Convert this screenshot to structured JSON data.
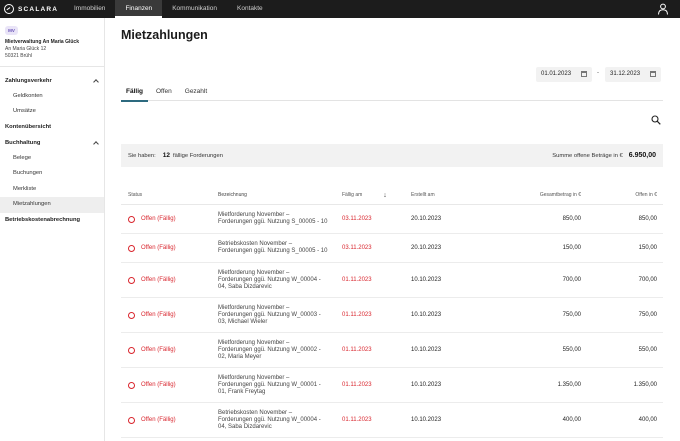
{
  "app": {
    "logo_text": "SCALARA"
  },
  "nav": {
    "items": [
      "Immobilien",
      "Finanzen",
      "Kommunikation",
      "Kontakte"
    ],
    "active": "Finanzen"
  },
  "sidebar": {
    "avatar": "MV",
    "name": "Mietverwaltung An Maria Glück",
    "address_line1": "An Maria Glück 12",
    "address_line2": "50321 Brühl",
    "groups": [
      {
        "label": "Zahlungsverkehr",
        "items": [
          "Geldkonten",
          "Umsätze"
        ]
      },
      {
        "label": "Kontenübersicht",
        "items": []
      },
      {
        "label": "Buchhaltung",
        "items": [
          "Belege",
          "Buchungen",
          "Merkliste",
          "Mietzahlungen"
        ]
      },
      {
        "label": "Betriebskostenabrechnung",
        "items": []
      }
    ],
    "active_item": "Mietzahlungen"
  },
  "main": {
    "title": "Mietzahlungen",
    "date_from": "01.01.2023",
    "date_separator": "-",
    "date_to": "31.12.2023",
    "tabs": [
      "Fällig",
      "Offen",
      "Gezahlt"
    ],
    "active_tab": "Fällig",
    "summary": {
      "prefix": "Sie haben:",
      "count": "12",
      "suffix": "fällige Forderungen",
      "total_label": "Summe offene Beträge in €",
      "total_value": "6.950,00"
    },
    "table": {
      "headers": {
        "status": "Status",
        "bezeichnung": "Bezeichnung",
        "faellig": "Fällig am",
        "erstellt": "Erstellt am",
        "gesamt": "Gesamtbetrag in €",
        "offen": "Offen in €"
      },
      "rows": [
        {
          "status": "Offen (Fällig)",
          "bez": [
            "Mietforderung November –",
            "Forderungen ggü. Nutzung S_00005 - 10"
          ],
          "due": "03.11.2023",
          "created": "20.10.2023",
          "total": "850,00",
          "open": "850,00"
        },
        {
          "status": "Offen (Fällig)",
          "bez": [
            "Betriebskosten November –",
            "Forderungen ggü. Nutzung S_00005 - 10"
          ],
          "due": "03.11.2023",
          "created": "20.10.2023",
          "total": "150,00",
          "open": "150,00"
        },
        {
          "status": "Offen (Fällig)",
          "bez": [
            "Mietforderung November –",
            "Forderungen ggü. Nutzung W_00004 -",
            "04, Saba Dizdarevic"
          ],
          "due": "01.11.2023",
          "created": "10.10.2023",
          "total": "700,00",
          "open": "700,00"
        },
        {
          "status": "Offen (Fällig)",
          "bez": [
            "Mietforderung November –",
            "Forderungen ggü. Nutzung W_00003 -",
            "03, Michael Wieler"
          ],
          "due": "01.11.2023",
          "created": "10.10.2023",
          "total": "750,00",
          "open": "750,00"
        },
        {
          "status": "Offen (Fällig)",
          "bez": [
            "Mietforderung November –",
            "Forderungen ggü. Nutzung W_00002 -",
            "02, Maria Meyer"
          ],
          "due": "01.11.2023",
          "created": "10.10.2023",
          "total": "550,00",
          "open": "550,00"
        },
        {
          "status": "Offen (Fällig)",
          "bez": [
            "Mietforderung November –",
            "Forderungen ggü. Nutzung W_00001 -",
            "01, Frank Freytag"
          ],
          "due": "01.11.2023",
          "created": "10.10.2023",
          "total": "1.350,00",
          "open": "1.350,00"
        },
        {
          "status": "Offen (Fällig)",
          "bez": [
            "Betriebskosten November –",
            "Forderungen ggü. Nutzung W_00004 -",
            "04, Saba Dizdarevic"
          ],
          "due": "01.11.2023",
          "created": "10.10.2023",
          "total": "400,00",
          "open": "400,00"
        }
      ]
    }
  },
  "colors": {
    "accent": "#2d6a7f",
    "overdue": "#d9262e",
    "topbar": "#1c1c1c"
  },
  "icons": {
    "logo": "scalara-logo-icon",
    "user": "user-icon",
    "search": "search-icon",
    "calendar": "calendar-icon",
    "sort": "sort-desc-icon",
    "chevron": "chevron-up-icon"
  }
}
